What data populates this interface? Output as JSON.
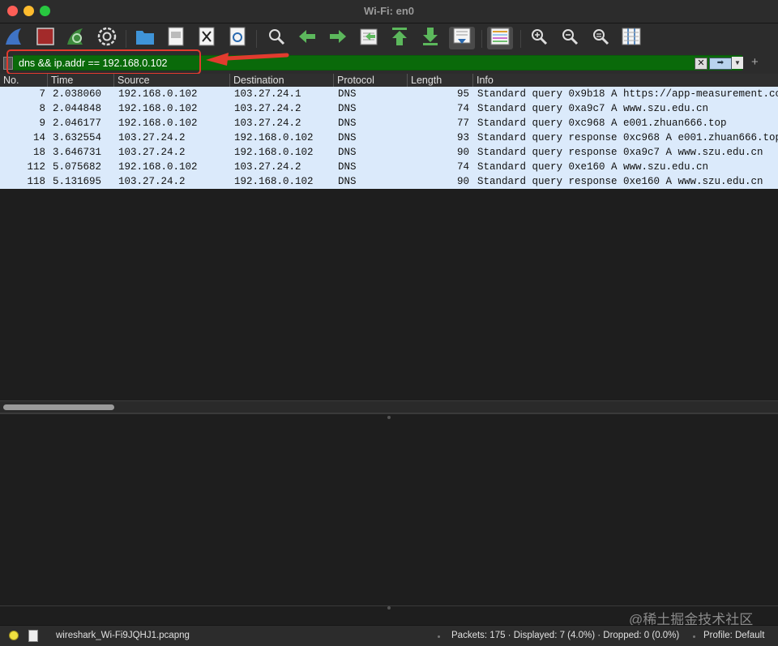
{
  "window": {
    "title": "Wi-Fi: en0"
  },
  "filter": {
    "value": "dns && ip.addr == 192.168.0.102",
    "plus_label": "+"
  },
  "columns": [
    "No.",
    "Time",
    "Source",
    "Destination",
    "Protocol",
    "Length",
    "Info"
  ],
  "packets": [
    {
      "no": "7",
      "time": "2.038060",
      "source": "192.168.0.102",
      "destination": "103.27.24.1",
      "protocol": "DNS",
      "length": "95",
      "info": "Standard query 0x9b18 A https://app-measurement.co"
    },
    {
      "no": "8",
      "time": "2.044848",
      "source": "192.168.0.102",
      "destination": "103.27.24.2",
      "protocol": "DNS",
      "length": "74",
      "info": "Standard query 0xa9c7 A www.szu.edu.cn"
    },
    {
      "no": "9",
      "time": "2.046177",
      "source": "192.168.0.102",
      "destination": "103.27.24.2",
      "protocol": "DNS",
      "length": "77",
      "info": "Standard query 0xc968 A e001.zhuan666.top"
    },
    {
      "no": "14",
      "time": "3.632554",
      "source": "103.27.24.2",
      "destination": "192.168.0.102",
      "protocol": "DNS",
      "length": "93",
      "info": "Standard query response 0xc968 A e001.zhuan666.top"
    },
    {
      "no": "18",
      "time": "3.646731",
      "source": "103.27.24.2",
      "destination": "192.168.0.102",
      "protocol": "DNS",
      "length": "90",
      "info": "Standard query response 0xa9c7 A www.szu.edu.cn"
    },
    {
      "no": "112",
      "time": "5.075682",
      "source": "192.168.0.102",
      "destination": "103.27.24.2",
      "protocol": "DNS",
      "length": "74",
      "info": "Standard query 0xe160 A www.szu.edu.cn"
    },
    {
      "no": "118",
      "time": "5.131695",
      "source": "103.27.24.2",
      "destination": "192.168.0.102",
      "protocol": "DNS",
      "length": "90",
      "info": "Standard query response 0xe160 A www.szu.edu.cn"
    }
  ],
  "status": {
    "file": "wireshark_Wi-Fi9JQHJ1.pcapng",
    "packets": "Packets: 175 · Displayed: 7 (4.0%) · Dropped: 0 (0.0%)",
    "profile": "Profile: Default"
  },
  "watermark": "@稀土掘金技术社区",
  "icons": {
    "start": "shark-fin-icon",
    "stop": "stop-square-icon",
    "restart": "restart-fin-icon",
    "options": "gear-icon",
    "open": "folder-icon",
    "save": "save-file-icon",
    "close": "close-file-icon",
    "reload": "reload-icon",
    "find": "magnifier-icon",
    "back": "arrow-left-icon",
    "forward": "arrow-right-icon",
    "goto": "goto-packet-icon",
    "first": "first-packet-icon",
    "last": "last-packet-icon",
    "autoscroll": "autoscroll-icon",
    "colorize": "colorize-icon",
    "zoom_in": "zoom-in-icon",
    "zoom_out": "zoom-out-icon",
    "zoom_reset": "zoom-reset-icon",
    "resize_columns": "resize-columns-icon"
  },
  "colors": {
    "filter_valid": "#0a6a0a",
    "row_dns": "#dbeafb",
    "annotation": "#e23b2e"
  }
}
